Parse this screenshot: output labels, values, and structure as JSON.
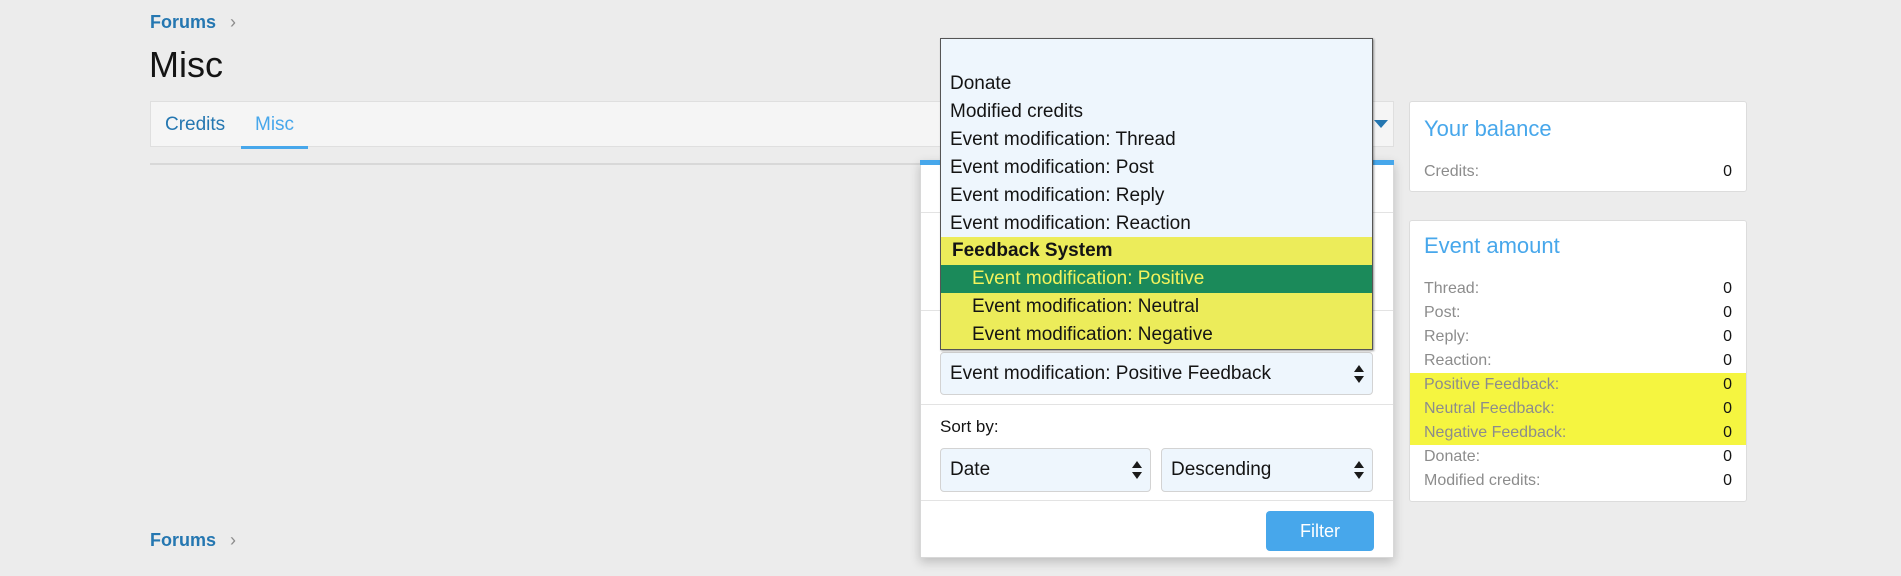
{
  "breadcrumb_top": {
    "label": "Forums"
  },
  "page_title": "Misc",
  "tabs": [
    {
      "label": "Credits"
    },
    {
      "label": "Misc"
    }
  ],
  "dropdown": {
    "options": [
      {
        "label": "Donate"
      },
      {
        "label": "Modified credits"
      },
      {
        "label": "Event modification: Thread"
      },
      {
        "label": "Event modification: Post"
      },
      {
        "label": "Event modification: Reply"
      },
      {
        "label": "Event modification: Reaction"
      }
    ],
    "group": {
      "label": "Feedback System"
    },
    "group_options": [
      {
        "label": "Event modification: Positive",
        "selected": true
      },
      {
        "label": "Event modification: Neutral"
      },
      {
        "label": "Event modification: Negative"
      }
    ]
  },
  "filter": {
    "event_select_value": "Event modification: Positive Feedback",
    "sort_label": "Sort by:",
    "sort_field": "Date",
    "sort_order": "Descending",
    "button_label": "Filter"
  },
  "balance": {
    "title": "Your balance",
    "rows": [
      {
        "key": "Credits:",
        "value": "0"
      }
    ]
  },
  "event_amount": {
    "title": "Event amount",
    "rows": [
      {
        "key": "Thread:",
        "value": "0"
      },
      {
        "key": "Post:",
        "value": "0"
      },
      {
        "key": "Reply:",
        "value": "0"
      },
      {
        "key": "Reaction:",
        "value": "0"
      },
      {
        "key": "Positive Feedback:",
        "value": "0"
      },
      {
        "key": "Neutral Feedback:",
        "value": "0"
      },
      {
        "key": "Negative Feedback:",
        "value": "0"
      },
      {
        "key": "Donate:",
        "value": "0"
      },
      {
        "key": "Modified credits:",
        "value": "0"
      }
    ]
  },
  "breadcrumb_bottom": {
    "label": "Forums"
  },
  "colors": {
    "link": "#2577b1",
    "accent": "#47a7eb",
    "highlight": "#f5f540",
    "selected_option": "#1b8a5a"
  }
}
